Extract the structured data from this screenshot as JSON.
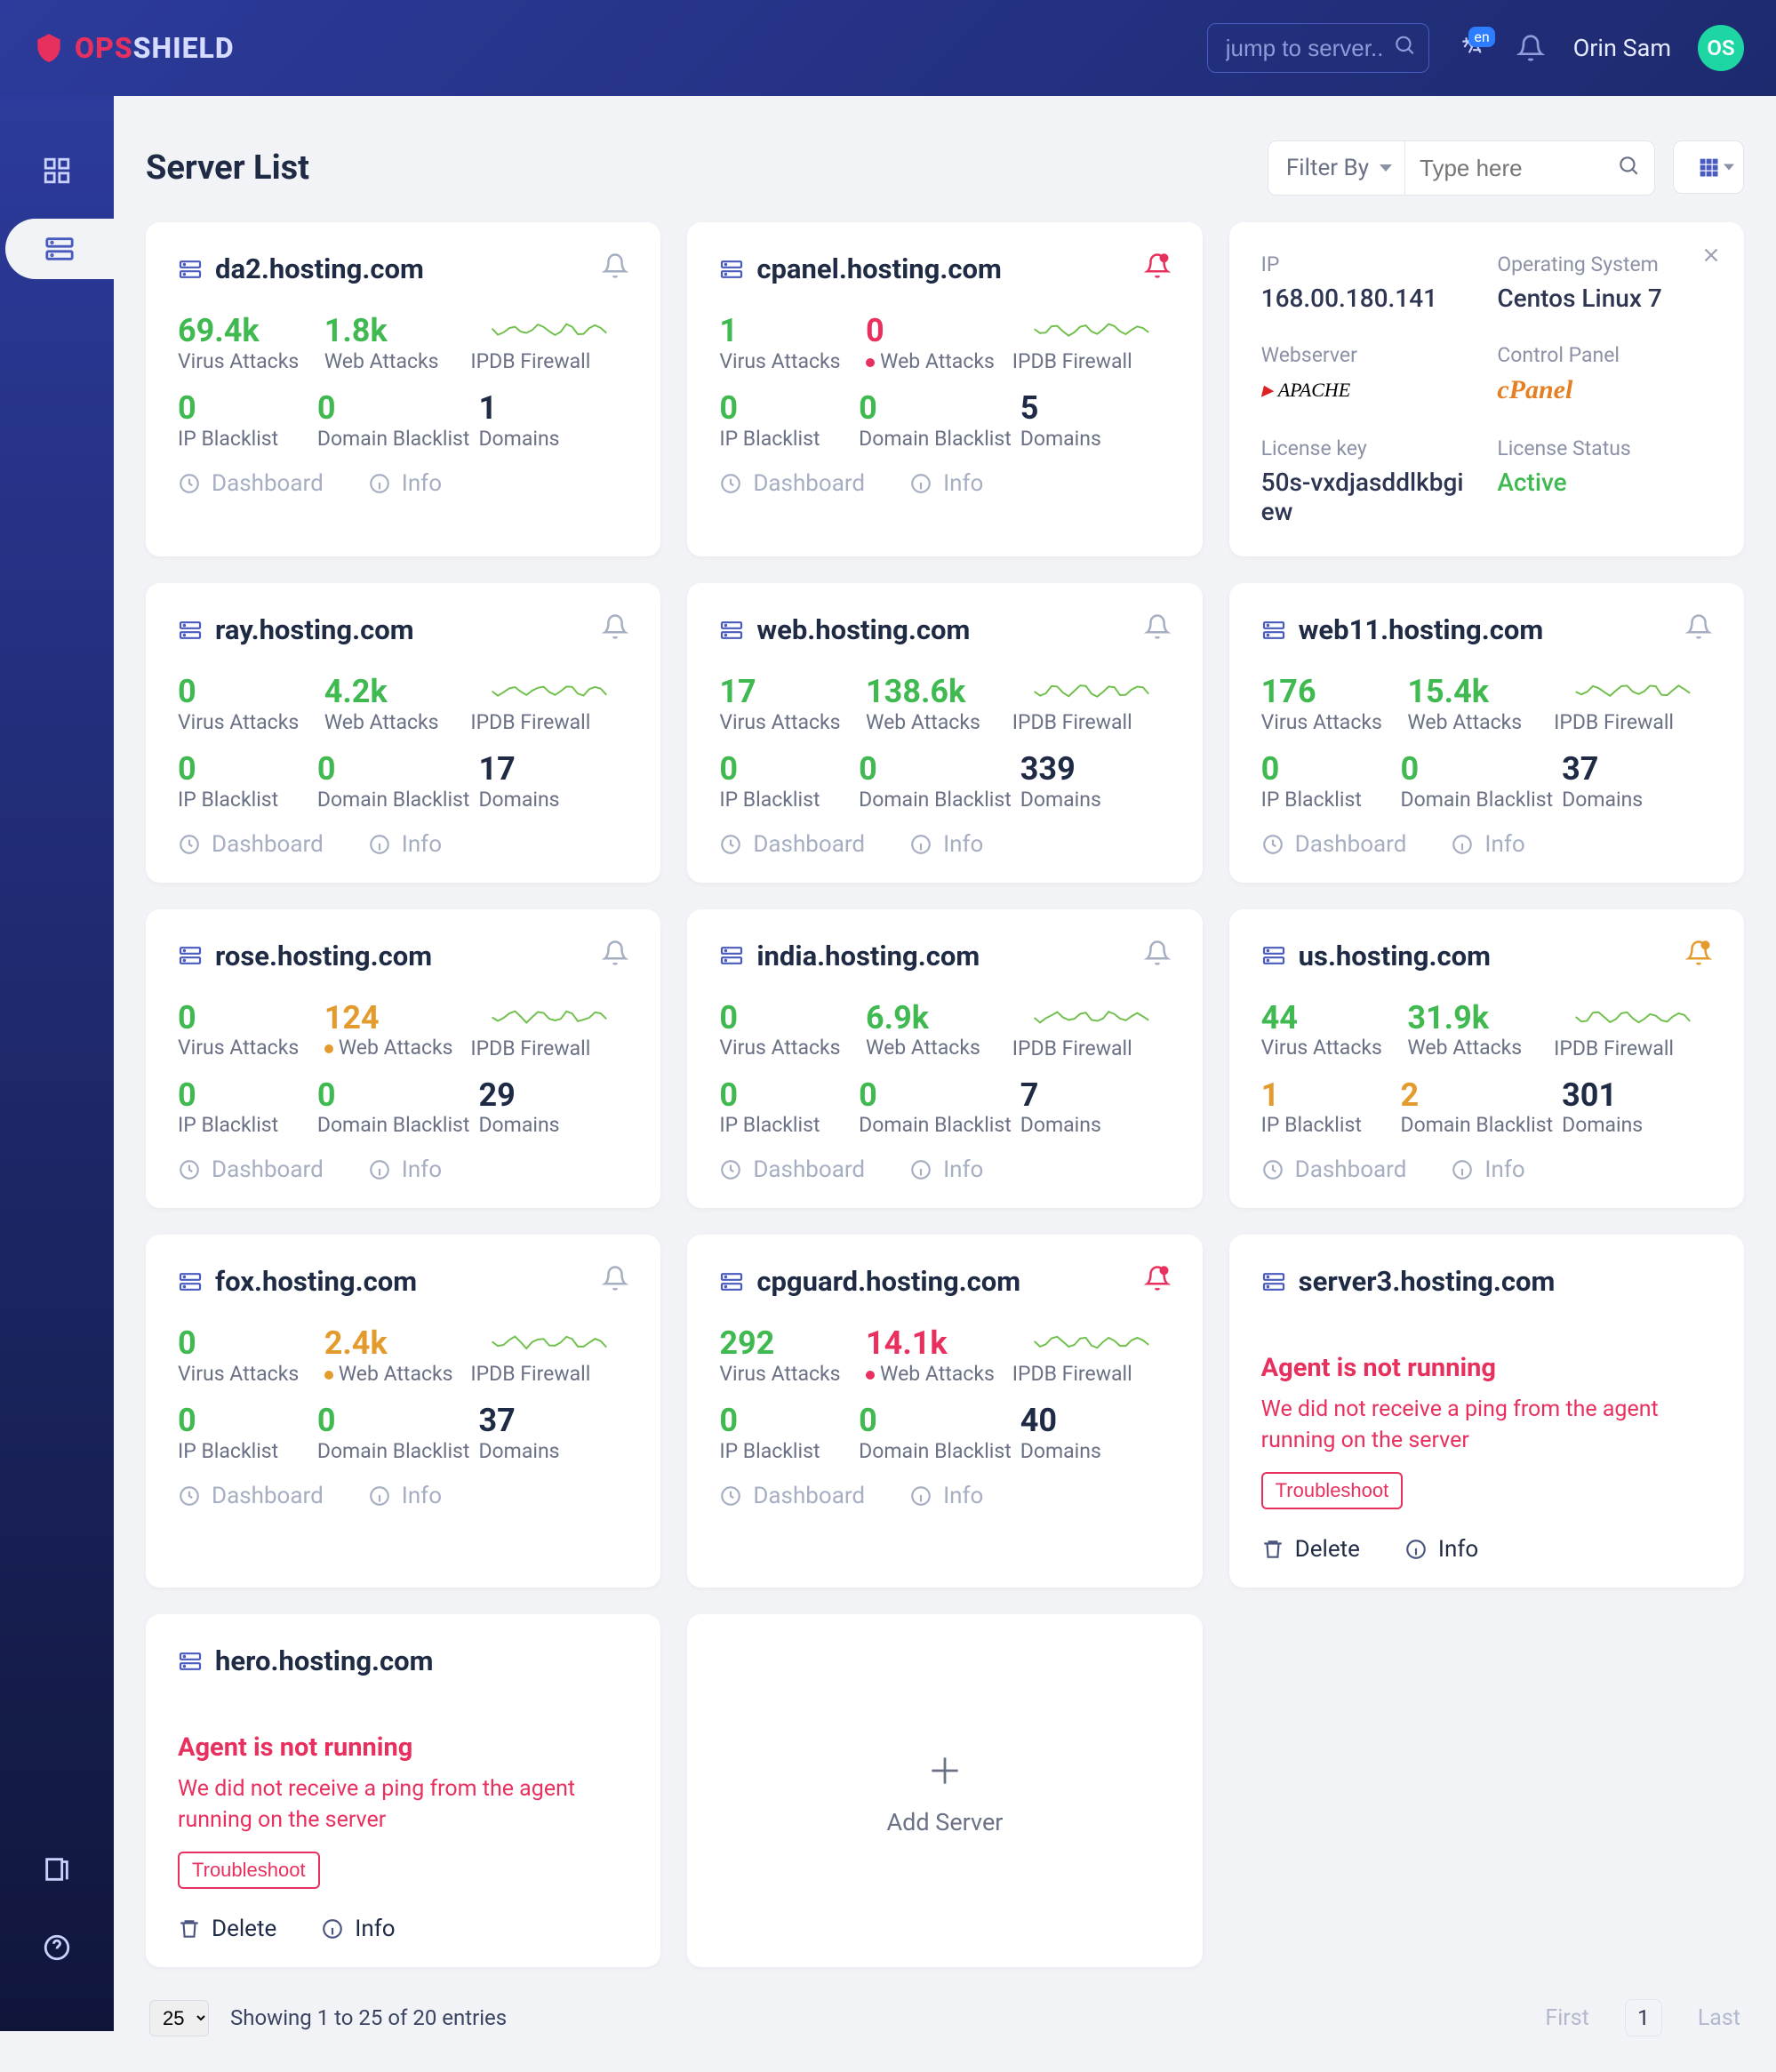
{
  "brand": {
    "ops": "OPS",
    "shield": "SHIELD"
  },
  "topbar": {
    "search_placeholder": "jump to server...",
    "lang_badge": "en",
    "user_name": "Orin Sam",
    "avatar_initials": "OS"
  },
  "page": {
    "title": "Server List",
    "filter_label": "Filter By",
    "type_placeholder": "Type here"
  },
  "labels": {
    "virus": "Virus Attacks",
    "web": "Web Attacks",
    "ipdb": "IPDB Firewall",
    "ipbl": "IP Blacklist",
    "dombl": "Domain Blacklist",
    "domains": "Domains",
    "dashboard": "Dashboard",
    "info": "Info",
    "delete": "Delete",
    "add_server": "Add Server",
    "agent_not_running": "Agent is not running",
    "agent_desc": "We did not receive a ping from the agent running on the server",
    "troubleshoot": "Troubleshoot"
  },
  "details": {
    "ip_label": "IP",
    "ip": "168.00.180.141",
    "os_label": "Operating System",
    "os": "Centos Linux 7",
    "ws_label": "Webserver",
    "ws": "APACHE",
    "cp_label": "Control Panel",
    "cp": "cPanel",
    "lk_label": "License key",
    "lk": "50s-vxdjasddlkbgiew",
    "ls_label": "License Status",
    "ls": "Active"
  },
  "servers": [
    {
      "name": "da2.hosting.com",
      "virus": "69.4k",
      "virus_color": "green",
      "web": "1.8k",
      "web_color": "green",
      "ipbl": "0",
      "ipbl_color": "green",
      "dombl": "0",
      "dombl_color": "green",
      "domains": "1",
      "bell": "normal"
    },
    {
      "name": "cpanel.hosting.com",
      "virus": "1",
      "virus_color": "green",
      "web": "0",
      "web_color": "red",
      "web_warn": "red",
      "ipbl": "0",
      "ipbl_color": "green",
      "dombl": "0",
      "dombl_color": "green",
      "domains": "5",
      "bell": "alert"
    },
    {
      "type": "details"
    },
    {
      "name": "ray.hosting.com",
      "virus": "0",
      "virus_color": "green",
      "web": "4.2k",
      "web_color": "green",
      "ipbl": "0",
      "ipbl_color": "green",
      "dombl": "0",
      "dombl_color": "green",
      "domains": "17",
      "bell": "normal"
    },
    {
      "name": "web.hosting.com",
      "virus": "17",
      "virus_color": "green",
      "web": "138.6k",
      "web_color": "green",
      "ipbl": "0",
      "ipbl_color": "green",
      "dombl": "0",
      "dombl_color": "green",
      "domains": "339",
      "bell": "normal"
    },
    {
      "name": "web11.hosting.com",
      "virus": "176",
      "virus_color": "green",
      "web": "15.4k",
      "web_color": "green",
      "ipbl": "0",
      "ipbl_color": "green",
      "dombl": "0",
      "dombl_color": "green",
      "domains": "37",
      "bell": "normal"
    },
    {
      "name": "rose.hosting.com",
      "virus": "0",
      "virus_color": "green",
      "web": "124",
      "web_color": "orange",
      "web_warn": "orange",
      "ipbl": "0",
      "ipbl_color": "green",
      "dombl": "0",
      "dombl_color": "green",
      "domains": "29",
      "bell": "normal"
    },
    {
      "name": "india.hosting.com",
      "virus": "0",
      "virus_color": "green",
      "web": "6.9k",
      "web_color": "green",
      "ipbl": "0",
      "ipbl_color": "green",
      "dombl": "0",
      "dombl_color": "green",
      "domains": "7",
      "bell": "normal"
    },
    {
      "name": "us.hosting.com",
      "virus": "44",
      "virus_color": "green",
      "web": "31.9k",
      "web_color": "green",
      "ipbl": "1",
      "ipbl_color": "orange",
      "dombl": "2",
      "dombl_color": "orange",
      "domains": "301",
      "bell": "warn"
    },
    {
      "name": "fox.hosting.com",
      "virus": "0",
      "virus_color": "green",
      "web": "2.4k",
      "web_color": "orange",
      "web_warn": "orange",
      "ipbl": "0",
      "ipbl_color": "green",
      "dombl": "0",
      "dombl_color": "green",
      "domains": "37",
      "bell": "normal"
    },
    {
      "name": "cpguard.hosting.com",
      "virus": "292",
      "virus_color": "green",
      "web": "14.1k",
      "web_color": "red",
      "web_warn": "red",
      "ipbl": "0",
      "ipbl_color": "green",
      "dombl": "0",
      "dombl_color": "green",
      "domains": "40",
      "bell": "alert"
    },
    {
      "type": "error",
      "name": "server3.hosting.com"
    },
    {
      "type": "error",
      "name": "hero.hosting.com"
    },
    {
      "type": "add"
    }
  ],
  "pagination": {
    "size": "25",
    "info": "Showing 1 to 25 of 20 entries",
    "first": "First",
    "last": "Last",
    "current": "1"
  }
}
